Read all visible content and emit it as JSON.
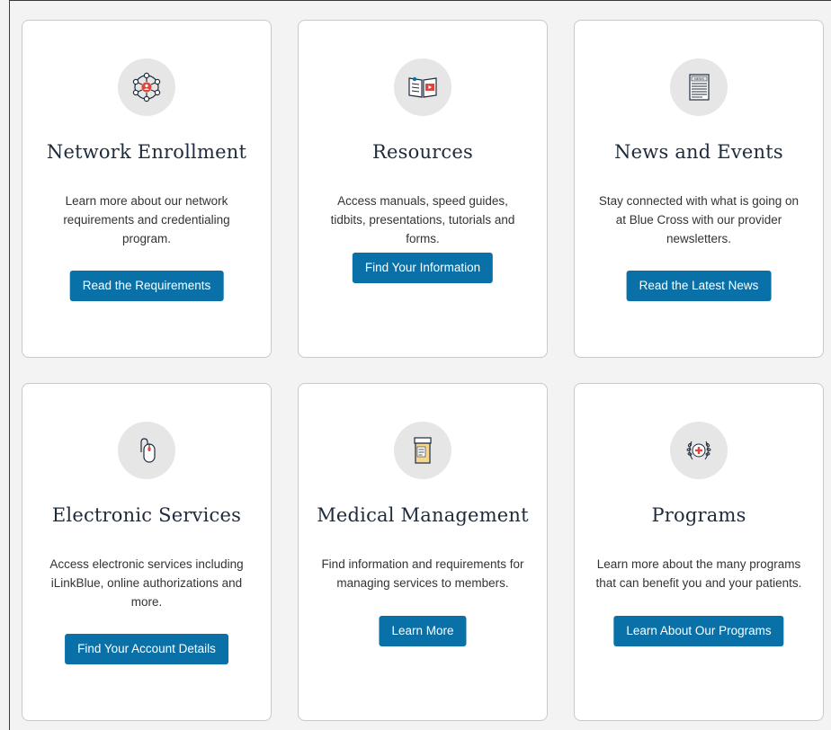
{
  "colors": {
    "button_bg": "#0a71a8",
    "button_text": "#ffffff",
    "title_text": "#1e2b3c",
    "icon_circle": "#e6e6e6",
    "accent_red": "#e0453a"
  },
  "cards": [
    {
      "icon": "network-icon",
      "title": "Network Enrollment",
      "description": "Learn more about our network requirements and credentialing program.",
      "button": "Read the Requirements"
    },
    {
      "icon": "resources-book-icon",
      "title": "Resources",
      "description": "Access manuals, speed guides, tidbits, presentations, tutorials and forms.",
      "button": "Find Your Information"
    },
    {
      "icon": "newspaper-icon",
      "title": "News and Events",
      "description": "Stay connected with what is going on at Blue Cross with our provider newsletters.",
      "button": "Read the Latest News"
    },
    {
      "icon": "mouse-icon",
      "title": "Electronic Services",
      "description": "Access electronic services including iLinkBlue, online authorizations and more.",
      "button": "Find Your Account Details"
    },
    {
      "icon": "pill-bottle-icon",
      "title": "Medical Management",
      "description": "Find information and requirements for managing services to members.",
      "button": "Learn More"
    },
    {
      "icon": "medical-laurel-icon",
      "title": "Programs",
      "description": "Learn more about the many programs that can benefit you and your patients.",
      "button": "Learn About Our Programs"
    }
  ],
  "news_icon_label": "NEWS"
}
